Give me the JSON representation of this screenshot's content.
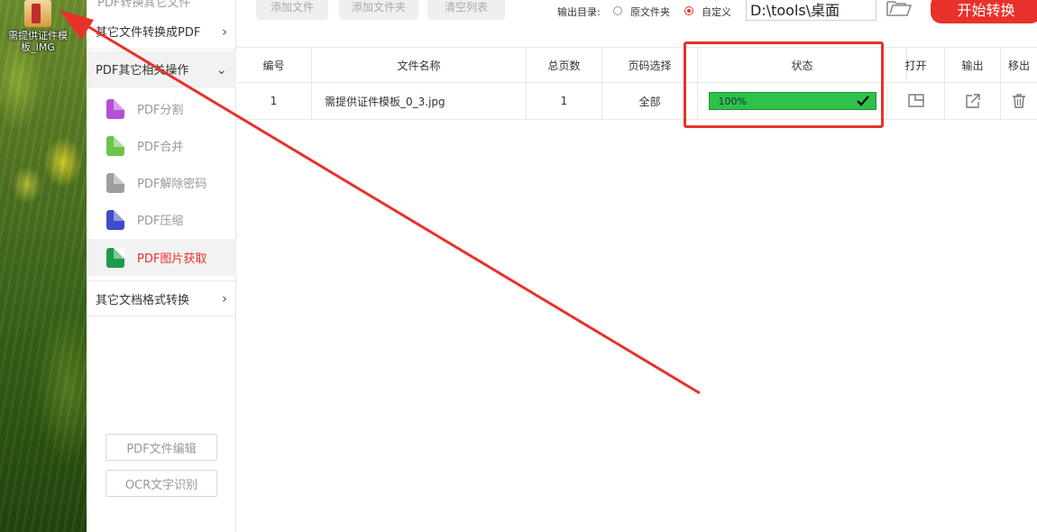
{
  "desktop": {
    "icon_label": "需提供证件模板_IMG"
  },
  "sidebar": {
    "cut_text": "PDF转换其它文件",
    "categories": [
      {
        "label": "其它文件转换成PDF",
        "arrow": "›"
      },
      {
        "label": "PDF其它相关操作",
        "arrow": "⌄"
      },
      {
        "label": "其它文档格式转换",
        "arrow": "›"
      }
    ],
    "items": [
      {
        "label": "PDF分割",
        "icon": "split-icon",
        "color": "#b54fd6"
      },
      {
        "label": "PDF合并",
        "icon": "merge-icon",
        "color": "#6dc44a"
      },
      {
        "label": "PDF解除密码",
        "icon": "unlock-icon",
        "color": "#9e9e9e"
      },
      {
        "label": "PDF压缩",
        "icon": "compress-icon",
        "color": "#3e4cc9"
      },
      {
        "label": "PDF图片获取",
        "icon": "image-extract-icon",
        "color": "#1f9a4a"
      }
    ],
    "buttons": {
      "pdf_edit": "PDF文件编辑",
      "ocr": "OCR文字识别"
    }
  },
  "toolbar": {
    "add_file": "添加文件",
    "add_folder": "添加文件夹",
    "clear_list": "清空列表",
    "output_dir_label": "输出目录:",
    "option_source": "原文件夹",
    "option_custom": "自定义",
    "selected_option": "custom",
    "output_path": "D:\\tools\\桌面",
    "start_label": "开始转换"
  },
  "table": {
    "headers": {
      "index": "编号",
      "filename": "文件名称",
      "pages": "总页数",
      "page_select": "页码选择",
      "status": "状态",
      "open": "打开",
      "output": "输出",
      "remove": "移出"
    },
    "rows": [
      {
        "index": "1",
        "filename": "需提供证件模板_0_3.jpg",
        "pages": "1",
        "page_select": "全部",
        "progress_text": "100%",
        "progress_fraction": 1.0,
        "status_done": true
      }
    ]
  },
  "colors": {
    "accent": "#e8312a",
    "progress": "#2ec24a"
  }
}
